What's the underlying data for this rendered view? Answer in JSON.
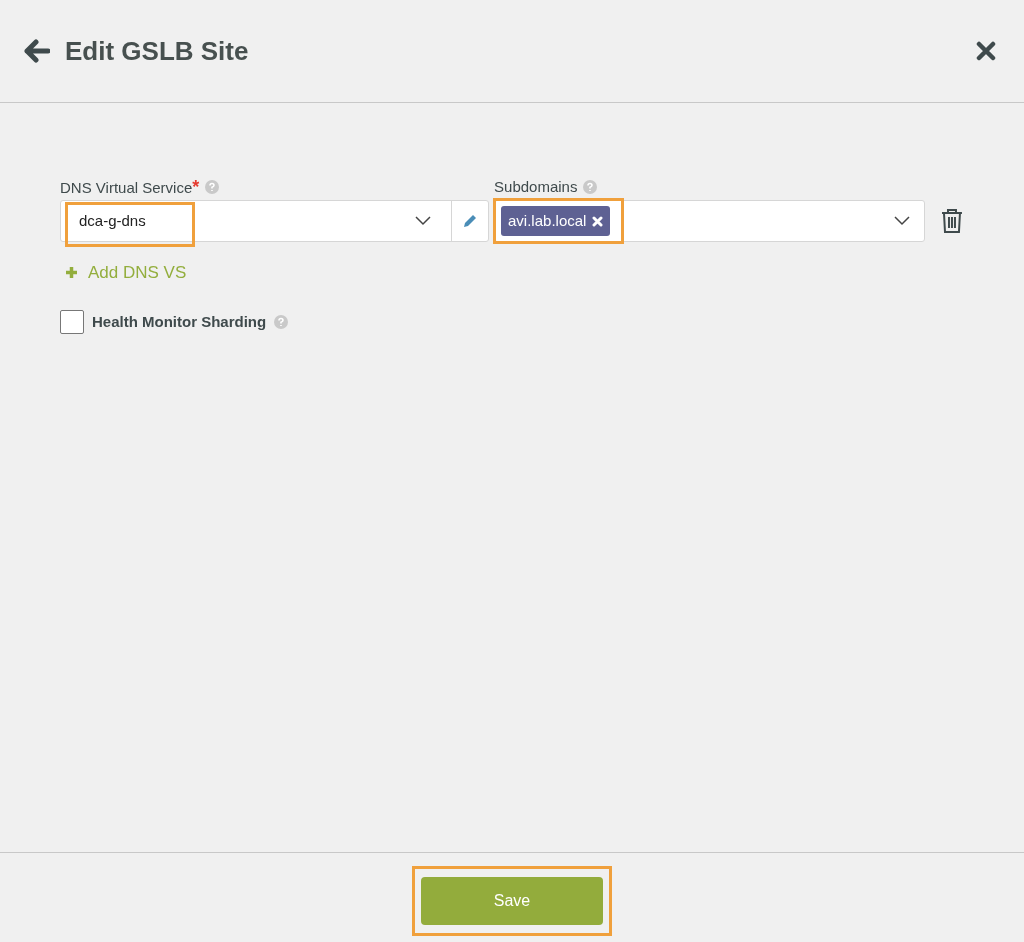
{
  "header": {
    "title": "Edit GSLB Site"
  },
  "dns_virtual_service": {
    "label": "DNS Virtual Service",
    "required_mark": "*",
    "value": "dca-g-dns",
    "highlighted": true
  },
  "subdomains": {
    "label": "Subdomains",
    "highlighted": true,
    "tags": [
      {
        "label": "avi.lab.local"
      }
    ]
  },
  "add_link": "Add DNS VS",
  "health_monitor_sharding": {
    "label": "Health Monitor Sharding",
    "checked": false
  },
  "footer": {
    "button": "Save",
    "highlighted": true
  }
}
